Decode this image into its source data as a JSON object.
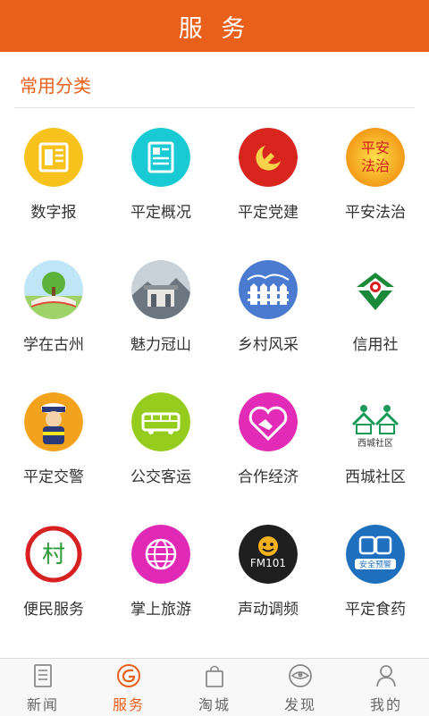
{
  "header": {
    "title": "服 务"
  },
  "section": {
    "title": "常用分类"
  },
  "grid": {
    "items": [
      {
        "label": "数字报",
        "icon": "newspaper-icon"
      },
      {
        "label": "平定概况",
        "icon": "document-icon"
      },
      {
        "label": "平定党建",
        "icon": "party-emblem-icon"
      },
      {
        "label": "平安法治",
        "icon": "peace-law-icon",
        "icon_text": "平安法治"
      },
      {
        "label": "学在古州",
        "icon": "book-tree-icon"
      },
      {
        "label": "魅力冠山",
        "icon": "mountain-temple-icon"
      },
      {
        "label": "乡村风采",
        "icon": "fence-icon"
      },
      {
        "label": "信用社",
        "icon": "credit-union-logo-icon"
      },
      {
        "label": "平定交警",
        "icon": "traffic-police-icon"
      },
      {
        "label": "公交客运",
        "icon": "bus-icon"
      },
      {
        "label": "合作经济",
        "icon": "handshake-heart-icon"
      },
      {
        "label": "西城社区",
        "icon": "community-houses-icon",
        "icon_text": "西城社区"
      },
      {
        "label": "便民服务",
        "icon": "village-service-icon",
        "icon_text": "村"
      },
      {
        "label": "掌上旅游",
        "icon": "globe-icon"
      },
      {
        "label": "声动调频",
        "icon": "fm-radio-icon",
        "icon_text": "FM101"
      },
      {
        "label": "平定食药",
        "icon": "food-safety-icon",
        "icon_text": "安全预警"
      }
    ]
  },
  "tabbar": {
    "tabs": [
      {
        "label": "新闻",
        "icon": "news-icon"
      },
      {
        "label": "服务",
        "icon": "service-icon"
      },
      {
        "label": "淘城",
        "icon": "shopping-bag-icon"
      },
      {
        "label": "发现",
        "icon": "eye-icon"
      },
      {
        "label": "我的",
        "icon": "user-icon"
      }
    ],
    "active_index": 1
  },
  "colors": {
    "accent": "#e9601b",
    "text": "#333333"
  }
}
